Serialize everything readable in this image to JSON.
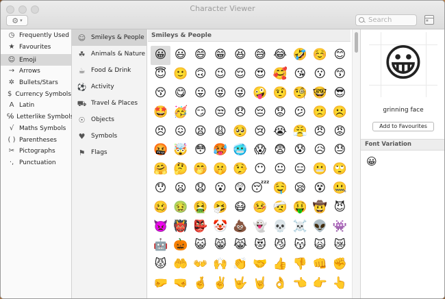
{
  "window": {
    "title": "Character Viewer"
  },
  "toolbar": {
    "search_placeholder": "Search"
  },
  "sidebar": {
    "items": [
      {
        "label": "Frequently Used",
        "icon": "clock-icon",
        "glyph": "◷"
      },
      {
        "label": "Favourites",
        "icon": "star-icon",
        "glyph": "★"
      },
      {
        "label": "Emoji",
        "icon": "smiley-icon",
        "glyph": "☺"
      },
      {
        "label": "Arrows",
        "icon": "arrow-icon",
        "glyph": "→"
      },
      {
        "label": "Bullets/Stars",
        "icon": "bullet-star-icon",
        "glyph": "✲"
      },
      {
        "label": "Currency Symbols",
        "icon": "dollar-icon",
        "glyph": "$"
      },
      {
        "label": "Latin",
        "icon": "latin-a-icon",
        "glyph": "A"
      },
      {
        "label": "Letterlike Symbols",
        "icon": "letterlike-icon",
        "glyph": "℅"
      },
      {
        "label": "Maths Symbols",
        "icon": "sqrt-icon",
        "glyph": "√"
      },
      {
        "label": "Parentheses",
        "icon": "parentheses-icon",
        "glyph": "( )"
      },
      {
        "label": "Pictographs",
        "icon": "pictograph-icon",
        "glyph": "✂"
      },
      {
        "label": "Punctuation",
        "icon": "punctuation-icon",
        "glyph": "·,"
      }
    ]
  },
  "categories": {
    "items": [
      {
        "label": "Smileys & People",
        "icon": "smiley-icon",
        "glyph": "☺"
      },
      {
        "label": "Animals & Nature",
        "icon": "paw-icon",
        "glyph": "☘"
      },
      {
        "label": "Food & Drink",
        "icon": "food-icon",
        "glyph": "☕"
      },
      {
        "label": "Activity",
        "icon": "ball-icon",
        "glyph": "⚽"
      },
      {
        "label": "Travel & Places",
        "icon": "car-icon",
        "glyph": "⛟"
      },
      {
        "label": "Objects",
        "icon": "bulb-icon",
        "glyph": "☉"
      },
      {
        "label": "Symbols",
        "icon": "symbols-icon",
        "glyph": "♥"
      },
      {
        "label": "Flags",
        "icon": "flag-icon",
        "glyph": "⚑"
      }
    ]
  },
  "grid": {
    "header": "Smileys & People",
    "emojis": [
      "😀",
      "😃",
      "😄",
      "😁",
      "😆",
      "😅",
      "😂",
      "🤣",
      "☺️",
      "😊",
      "😇",
      "🙂",
      "🙃",
      "😉",
      "😌",
      "😍",
      "🥰",
      "😘",
      "😗",
      "😙",
      "😚",
      "😋",
      "😛",
      "😝",
      "😜",
      "🤪",
      "🤨",
      "🧐",
      "🤓",
      "😎",
      "🤩",
      "🥳",
      "😏",
      "😒",
      "😞",
      "😔",
      "😟",
      "😕",
      "🙁",
      "☹️",
      "😣",
      "😖",
      "😫",
      "😩",
      "🥺",
      "😢",
      "😭",
      "😤",
      "😠",
      "😡",
      "🤬",
      "🤯",
      "😳",
      "🥵",
      "🥶",
      "😱",
      "😨",
      "😰",
      "😥",
      "😓",
      "🤗",
      "🤔",
      "🤭",
      "🤫",
      "🤥",
      "😶",
      "😐",
      "😑",
      "😬",
      "🙄",
      "😯",
      "😦",
      "😧",
      "😮",
      "😲",
      "😴",
      "🤤",
      "😪",
      "😵",
      "🤐",
      "🥴",
      "🤢",
      "🤮",
      "🤧",
      "😷",
      "🤒",
      "🤕",
      "🤑",
      "🤠",
      "😈",
      "👿",
      "👹",
      "👺",
      "🤡",
      "💩",
      "👻",
      "💀",
      "☠️",
      "👽",
      "👾",
      "🤖",
      "🎃",
      "😺",
      "😸",
      "😹",
      "😻",
      "😼",
      "😽",
      "🙀",
      "😿",
      "😾",
      "🤲",
      "👐",
      "🙌",
      "👏",
      "🤝",
      "👍",
      "👎",
      "👊",
      "✊",
      "🤛",
      "🤜",
      "🤞",
      "✌️",
      "🤟",
      "🤘",
      "👌",
      "👈",
      "👉",
      "👆"
    ]
  },
  "detail": {
    "preview": "😀",
    "name": "grinning face",
    "favourites_button": "Add to Favourites",
    "font_variation_header": "Font Variation",
    "variations": [
      "😀"
    ]
  }
}
